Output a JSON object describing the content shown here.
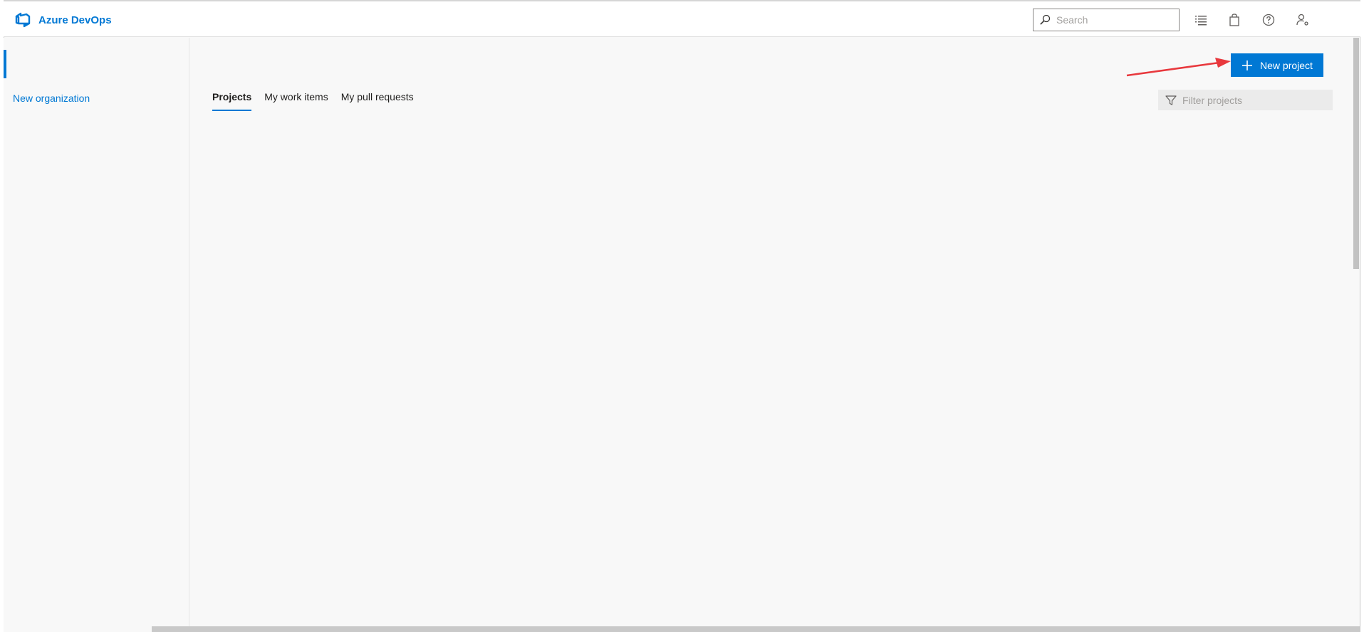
{
  "app": {
    "brand_name": "Azure DevOps",
    "brand_color": "#0078d4"
  },
  "header": {
    "search": {
      "placeholder": "Search",
      "value": ""
    },
    "icons": [
      "list-icon",
      "shopping-bag-icon",
      "help-icon",
      "user-settings-icon"
    ]
  },
  "sidebar": {
    "new_organization_label": "New organization"
  },
  "main": {
    "new_project_label": "New project",
    "tabs": [
      {
        "label": "Projects",
        "active": true
      },
      {
        "label": "My work items",
        "active": false
      },
      {
        "label": "My pull requests",
        "active": false
      }
    ],
    "filter": {
      "placeholder": "Filter projects",
      "value": ""
    }
  },
  "annotation": {
    "arrow_color": "#e8383d"
  }
}
